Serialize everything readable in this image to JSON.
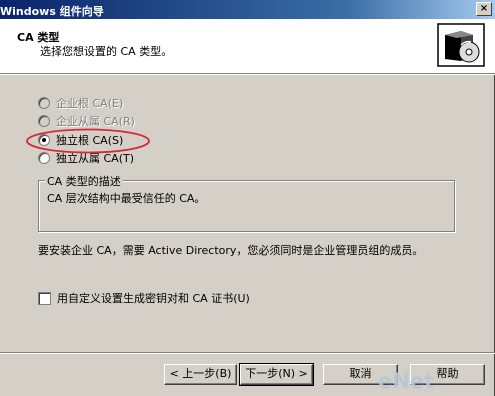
{
  "window": {
    "title": "Windows 组件向导",
    "close_label": "×"
  },
  "header": {
    "title": "CA 类型",
    "subtitle": "选择您想设置的 CA 类型。",
    "icon": "install-box-cd-icon"
  },
  "ca_types": [
    {
      "label": "企业根 CA(E)",
      "checked": false,
      "enabled": false
    },
    {
      "label": "企业从属 CA(R)",
      "checked": false,
      "enabled": false
    },
    {
      "label": "独立根 CA(S)",
      "checked": true,
      "enabled": true
    },
    {
      "label": "独立从属 CA(T)",
      "checked": false,
      "enabled": true
    }
  ],
  "description": {
    "legend": "CA 类型的描述",
    "text": "CA 层次结构中最受信任的 CA。"
  },
  "note": "要安装企业 CA，需要 Active Directory，您必须同时是企业管理员组的成员。",
  "custom_keys": {
    "label": "用自定义设置生成密钥对和 CA 证书(U)",
    "checked": false
  },
  "buttons": {
    "back": "< 上一步(B)",
    "next": "下一步(N) >",
    "cancel": "取消",
    "help": "帮助"
  },
  "watermark": "eNet",
  "colors": {
    "title_bar_start": "#0a246a",
    "highlight_ellipse": "#d8283c",
    "dialog_bg": "#d4d0c8"
  }
}
